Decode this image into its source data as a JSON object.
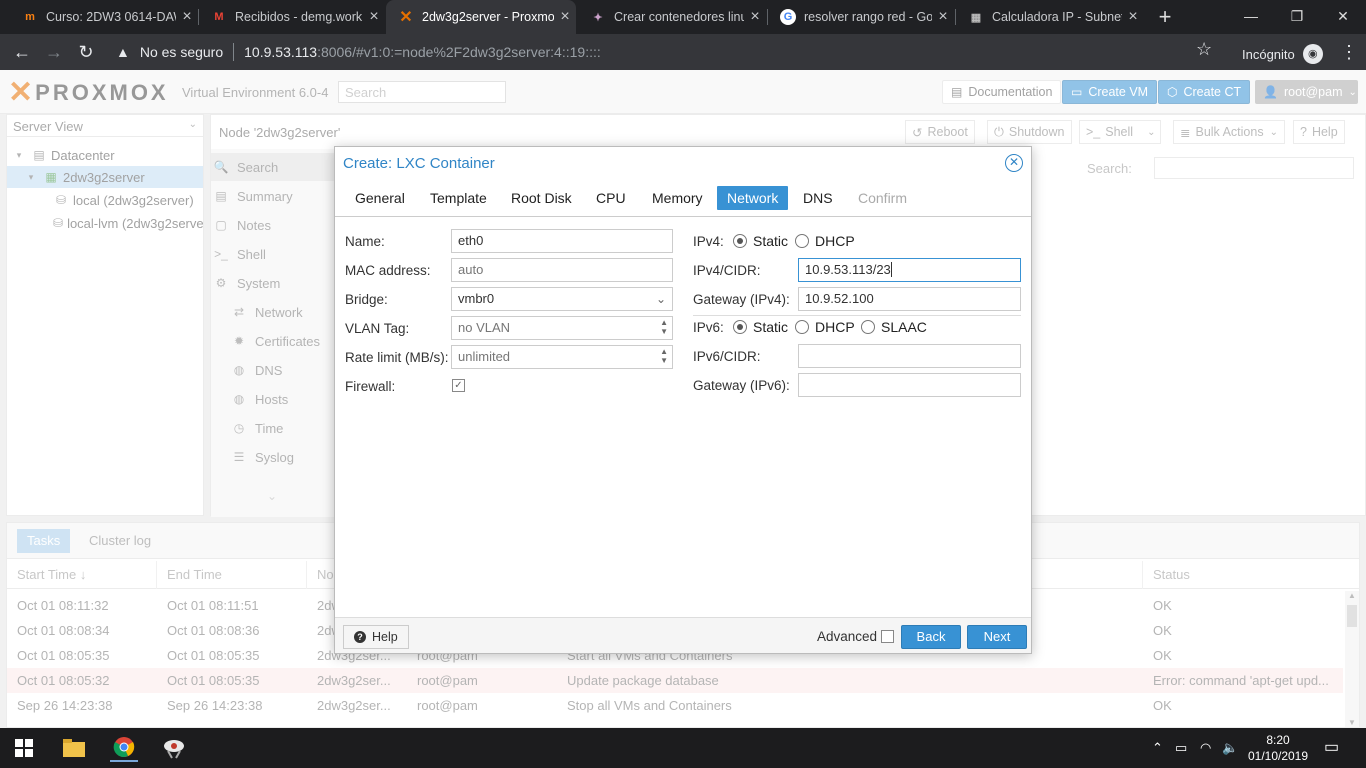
{
  "browser": {
    "tabs": [
      {
        "title": "Curso: 2DW3 0614-DAW",
        "icon": "moodle-icon"
      },
      {
        "title": "Recibidos - demg.work",
        "icon": "gmail-icon"
      },
      {
        "title": "2dw3g2server - Proxmox",
        "icon": "proxmox-icon"
      },
      {
        "title": "Crear contenedores linux",
        "icon": "web-icon"
      },
      {
        "title": "resolver rango red - Go",
        "icon": "google-icon"
      },
      {
        "title": "Calculadora IP - Subnet",
        "icon": "calculator-icon"
      }
    ],
    "url_warning": "No es seguro",
    "url_host": "10.9.53.113",
    "url_path": ":8006/#v1:0:=node%2F2dw3g2server:4::19::::",
    "incognito_label": "Incógnito"
  },
  "pve": {
    "brand": "PROXMOX",
    "version": "Virtual Environment 6.0-4",
    "search_placeholder": "Search",
    "header_buttons": {
      "documentation": "Documentation",
      "create_vm": "Create VM",
      "create_ct": "Create CT",
      "user": "root@pam"
    },
    "server_view": "Server View",
    "tree": {
      "datacenter": "Datacenter",
      "node": "2dw3g2server",
      "storage_local": "local (2dw3g2server)",
      "storage_lvm": "local-lvm (2dw3g2server)"
    },
    "node_title": "Node '2dw3g2server'",
    "node_buttons": {
      "reboot": "Reboot",
      "shutdown": "Shutdown",
      "shell": "Shell",
      "bulk": "Bulk Actions",
      "help": "Help"
    },
    "content_search_label": "Search:",
    "node_menu": {
      "search": "Search",
      "summary": "Summary",
      "notes": "Notes",
      "shell": "Shell",
      "system": "System",
      "network": "Network",
      "certificates": "Certificates",
      "dns": "DNS",
      "hosts": "Hosts",
      "time": "Time",
      "syslog": "Syslog"
    }
  },
  "tasks": {
    "tab_tasks": "Tasks",
    "tab_cluster": "Cluster log",
    "columns": {
      "start": "Start Time ↓",
      "end": "End Time",
      "node": "No",
      "status": "Status"
    },
    "rows": [
      {
        "start": "Oct 01 08:11:32",
        "end": "Oct 01 08:11:51",
        "node": "2dw3g2ser...",
        "user": "",
        "desc": "",
        "status": "OK"
      },
      {
        "start": "Oct 01 08:08:34",
        "end": "Oct 01 08:08:36",
        "node": "2dw3g2ser...",
        "user": "",
        "desc": "",
        "status": "OK"
      },
      {
        "start": "Oct 01 08:05:35",
        "end": "Oct 01 08:05:35",
        "node": "2dw3g2ser...",
        "user": "root@pam",
        "desc": "Start all VMs and Containers",
        "status": "OK"
      },
      {
        "start": "Oct 01 08:05:32",
        "end": "Oct 01 08:05:35",
        "node": "2dw3g2ser...",
        "user": "root@pam",
        "desc": "Update package database",
        "status": "Error: command 'apt-get upd..."
      },
      {
        "start": "Sep 26 14:23:38",
        "end": "Sep 26 14:23:38",
        "node": "2dw3g2ser...",
        "user": "root@pam",
        "desc": "Stop all VMs and Containers",
        "status": "OK"
      }
    ]
  },
  "dialog": {
    "title": "Create: LXC Container",
    "tabs": {
      "general": "General",
      "template": "Template",
      "root_disk": "Root Disk",
      "cpu": "CPU",
      "memory": "Memory",
      "network": "Network",
      "dns": "DNS",
      "confirm": "Confirm"
    },
    "labels": {
      "name": "Name:",
      "mac": "MAC address:",
      "bridge": "Bridge:",
      "vlan": "VLAN Tag:",
      "rate": "Rate limit (MB/s):",
      "firewall": "Firewall:",
      "ipv4": "IPv4:",
      "ipv4_cidr": "IPv4/CIDR:",
      "gw4": "Gateway (IPv4):",
      "ipv6": "IPv6:",
      "ipv6_cidr": "IPv6/CIDR:",
      "gw6": "Gateway (IPv6):"
    },
    "values": {
      "name": "eth0",
      "mac": "auto",
      "bridge": "vmbr0",
      "vlan": "no VLAN",
      "rate": "unlimited",
      "firewall_checked": "✓",
      "ipv4_cidr": "10.9.53.113/23",
      "gw4": "10.9.52.100",
      "ipv6_cidr": "",
      "gw6": ""
    },
    "radio": {
      "static": "Static",
      "dhcp": "DHCP",
      "slaac": "SLAAC"
    },
    "footer": {
      "help": "Help",
      "advanced": "Advanced",
      "back": "Back",
      "next": "Next"
    }
  },
  "taskbar": {
    "time": "8:20",
    "date": "01/10/2019"
  }
}
